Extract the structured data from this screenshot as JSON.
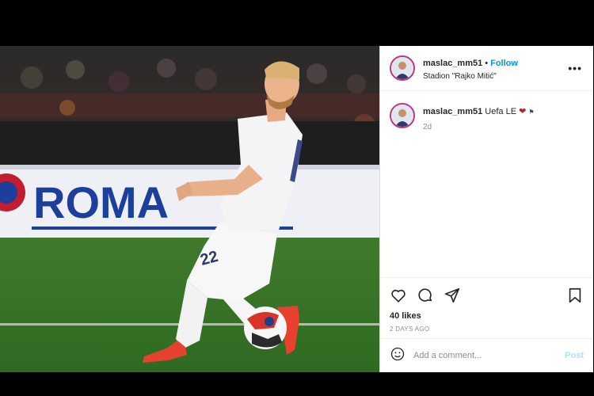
{
  "post": {
    "username": "maslac_mm51",
    "separator": "•",
    "follow_label": "Follow",
    "location": "Stadion \"Rajko Mitić\"",
    "more_label": "•••",
    "caption": {
      "username": "maslac_mm51",
      "text": "Uefa LE",
      "time": "2d"
    },
    "likes": "40 likes",
    "date_ago": "2 DAYS AGO",
    "comment_placeholder": "Add a comment...",
    "post_label": "Post",
    "icons": [
      "heart-icon",
      "comment-icon",
      "share-icon",
      "bookmark-icon",
      "emoji-icon"
    ],
    "colors": {
      "accent": "#0095f6",
      "post_disabled": "#b2dffc",
      "story_ring": "#c13584"
    }
  },
  "photo": {
    "banner_text": "ROMA",
    "jersey_number": "22"
  }
}
